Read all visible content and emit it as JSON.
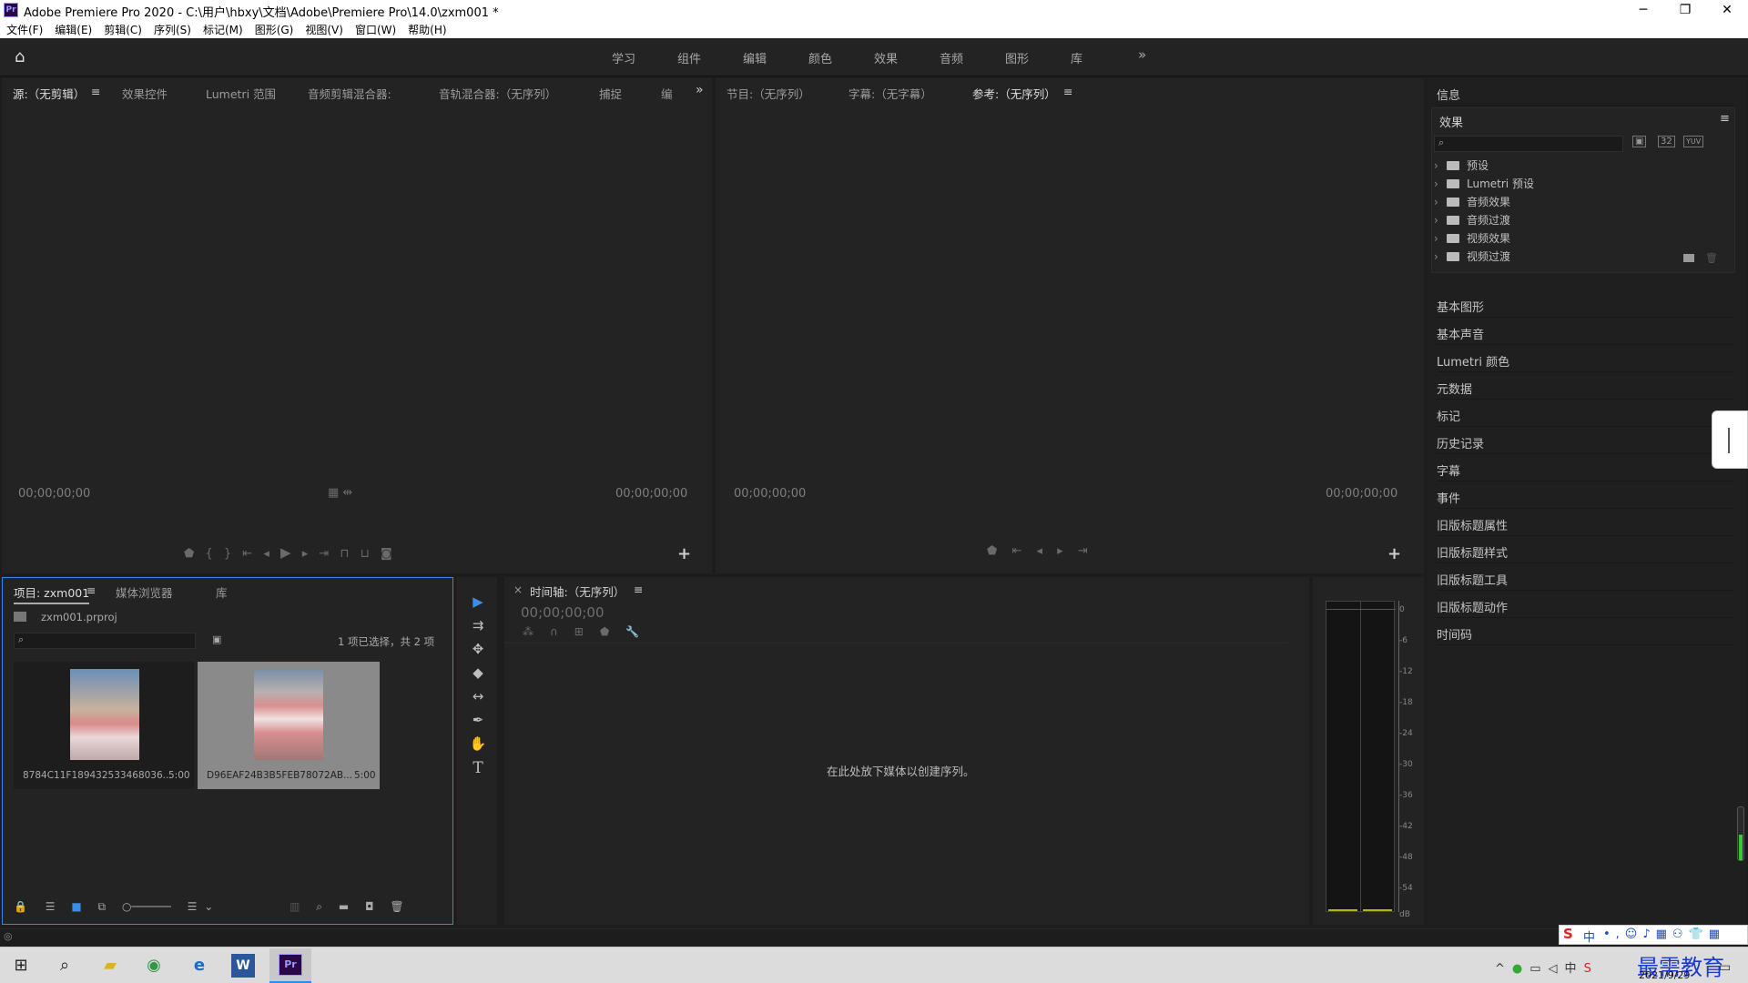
{
  "window": {
    "title": "Adobe Premiere Pro 2020 - C:\\用户\\hbxy\\文档\\Adobe\\Premiere Pro\\14.0\\zxm001 *",
    "app_icon_text": "Pr",
    "minimize": "─",
    "restore": "❐",
    "close": "✕"
  },
  "menu": [
    "文件(F)",
    "编辑(E)",
    "剪辑(C)",
    "序列(S)",
    "标记(M)",
    "图形(G)",
    "视图(V)",
    "窗口(W)",
    "帮助(H)"
  ],
  "workspaces": {
    "tabs": [
      "学习",
      "组件",
      "编辑",
      "颜色",
      "效果",
      "音频",
      "图形",
      "库"
    ],
    "overflow": "»"
  },
  "source_panel": {
    "tabs": [
      "源:（无剪辑）",
      "效果控件",
      "Lumetri 范围",
      "音频剪辑混合器:",
      "音轨混合器:（无序列）",
      "捕捉",
      "编"
    ],
    "menu_icon": "≡",
    "overflow": "»",
    "timecode_left": "00;00;00;00",
    "timecode_right": "00;00;00;00",
    "add": "+"
  },
  "program_panel": {
    "tabs": [
      "节目:（无序列）",
      "字幕:（无字幕）",
      "参考:（无序列）"
    ],
    "menu_icon": "≡",
    "timecode_left": "00;00;00;00",
    "timecode_right": "00;00;00;00",
    "add": "+"
  },
  "right_panel": {
    "info_label": "信息",
    "effects_label": "效果",
    "menu_icon": "≡",
    "tree": [
      "预设",
      "Lumetri 预设",
      "音频效果",
      "音频过渡",
      "视频效果",
      "视频过渡"
    ],
    "badge_32": "32",
    "badge_yuv": "YUV",
    "sections": [
      "基本图形",
      "基本声音",
      "Lumetri 颜色",
      "元数据",
      "标记",
      "历史记录",
      "字幕",
      "事件",
      "旧版标题属性",
      "旧版标题样式",
      "旧版标题工具",
      "旧版标题动作",
      "时间码"
    ]
  },
  "project_panel": {
    "tabs": [
      "项目: zxm001",
      "媒体浏览器",
      "库"
    ],
    "menu_icon": "≡",
    "file_name": "zxm001.prproj",
    "selection_status": "1 项已选择，共 2 项",
    "clips": [
      {
        "name": "8784C11F189432533468036...",
        "duration": "5:00"
      },
      {
        "name": "D96EAF24B3B5FEB78072AB...",
        "duration": "5:00"
      }
    ]
  },
  "timeline_panel": {
    "close": "×",
    "title": "时间轴:（无序列）",
    "menu_icon": "≡",
    "timecode": "00;00;00;00",
    "drop_hint": "在此处放下媒体以创建序列。"
  },
  "tools": [
    "▶",
    "⇉",
    "✥",
    "◆",
    "↔",
    "✒",
    "✋",
    "T"
  ],
  "meter": {
    "scale": [
      "0",
      "-6",
      "-12",
      "-18",
      "-24",
      "-30",
      "-36",
      "-42",
      "-48",
      "-54",
      "dB"
    ]
  },
  "taskbar": {
    "date": "2021/9/29",
    "watermark": "最需教育",
    "ime": "中"
  },
  "colors": {
    "panel_bg": "#232323",
    "frame_bg": "#1d1d1d",
    "accent_blue": "#2d8ceb",
    "meter_green": "#33cc33"
  }
}
